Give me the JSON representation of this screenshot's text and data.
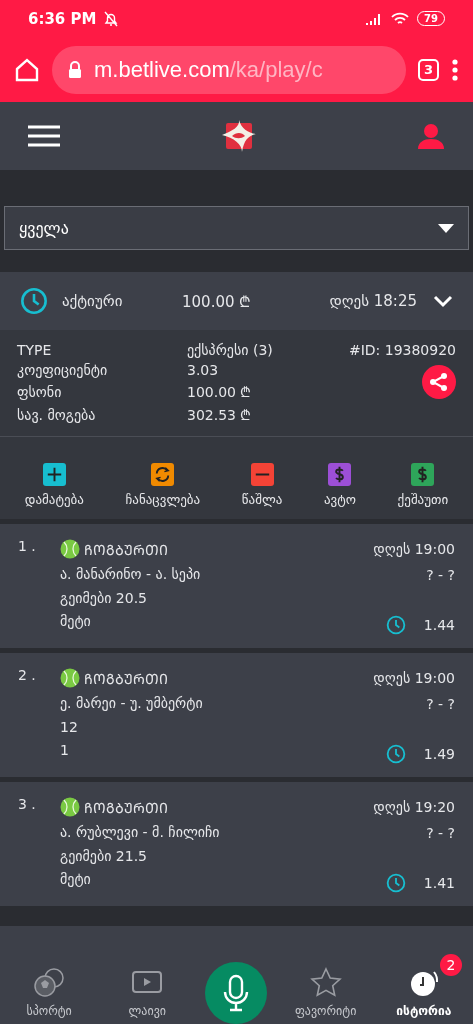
{
  "status_bar": {
    "time": "6:36 PM",
    "battery": "79"
  },
  "browser": {
    "url_host": "m.betlive.com",
    "url_path": "/ka/play/c",
    "tab_count": "3"
  },
  "filter": {
    "value": "ყველა"
  },
  "bets": [
    {
      "status": "აქტიური",
      "amount": "100.00 ₾",
      "time": "დღეს 18:25",
      "expanded": true,
      "details": [
        {
          "label": "TYPE",
          "value": "ექსპრესი (3)"
        },
        {
          "label": "კოეფიციენტი",
          "value": "3.03"
        },
        {
          "label": "ფსონი",
          "value": "100.00 ₾"
        },
        {
          "label": "სავ. მოგება",
          "value": "302.53 ₾"
        }
      ],
      "id": "#ID: 19380920",
      "actions": [
        {
          "kind": "add",
          "label": "დამატება",
          "color": "#17bed0"
        },
        {
          "kind": "swap",
          "label": "ჩანაცვლება",
          "color": "#f08a00"
        },
        {
          "kind": "remove",
          "label": "წაშლა",
          "color": "#f44336"
        },
        {
          "kind": "dollar",
          "label": "ავტო",
          "color": "#9c4fd6"
        },
        {
          "kind": "dollar",
          "label": "ქეშაუთი",
          "color": "#2ea55a"
        }
      ],
      "legs": [
        {
          "index": "1 .",
          "sport": "ᲩᲝᲒᲑᲣᲠᲗᲘ",
          "time": "დღეს 19:00",
          "match": "ა. მანარინო - ა. სეპი",
          "score": "? - ?",
          "market": "გეიმები 20.5",
          "pick": "მეტი",
          "odds": "1.44"
        },
        {
          "index": "2 .",
          "sport": "ᲩᲝᲒᲑᲣᲠᲗᲘ",
          "time": "დღეს 19:00",
          "match": "ე. მარეი - უ. უმბერტი",
          "score": "? - ?",
          "market": "12",
          "pick": "1",
          "odds": "1.49"
        },
        {
          "index": "3 .",
          "sport": "ᲩᲝᲒᲑᲣᲠᲗᲘ",
          "time": "დღეს 19:20",
          "match": "ა. რუბლევი - მ. ჩილიჩი",
          "score": "? - ?",
          "market": "გეიმები 21.5",
          "pick": "მეტი",
          "odds": "1.41"
        }
      ]
    }
  ],
  "bottom_nav": [
    {
      "kind": "sports",
      "label": "სპორტი",
      "selected": false
    },
    {
      "kind": "live",
      "label": "ლაივი",
      "selected": false
    },
    {
      "kind": "mic"
    },
    {
      "kind": "star",
      "label": "ფავორიტი",
      "selected": false
    },
    {
      "kind": "history",
      "label": "ისტორია",
      "selected": true,
      "badge": "2"
    }
  ]
}
